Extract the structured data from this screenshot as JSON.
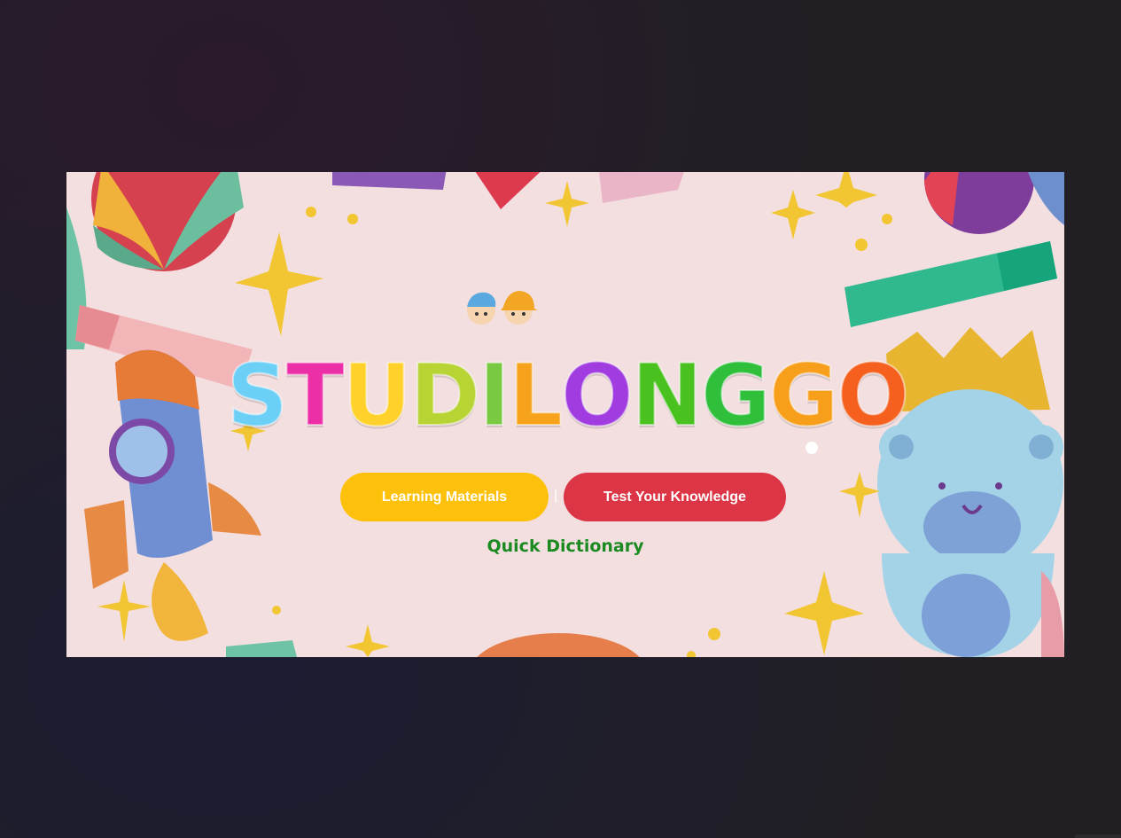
{
  "hero": {
    "logo_text": "STUDILONGGO",
    "logo_colors": [
      "#6ccff6",
      "#ec2fa6",
      "#ffd12a",
      "#b7d334",
      "#7ac943",
      "#f7a21b",
      "#a13de0",
      "#49c21f",
      "#2fbf3a",
      "#f79e1b",
      "#f5601f",
      "#49c21f"
    ],
    "buttons": {
      "learning": "Learning Materials",
      "separator": "|",
      "test": "Test Your Knowledge"
    },
    "dictionary_link": "Quick Dictionary"
  },
  "colors": {
    "learning_button": "#fdc10c",
    "test_button": "#dc3545",
    "dictionary_link": "#1b8a21",
    "banner_bg": "#f3dfe0"
  },
  "icons": [
    "beach-ball-icon",
    "star-icon",
    "rocket-icon",
    "teddy-bear-icon",
    "crown-icon",
    "kids-avatar-icon"
  ]
}
